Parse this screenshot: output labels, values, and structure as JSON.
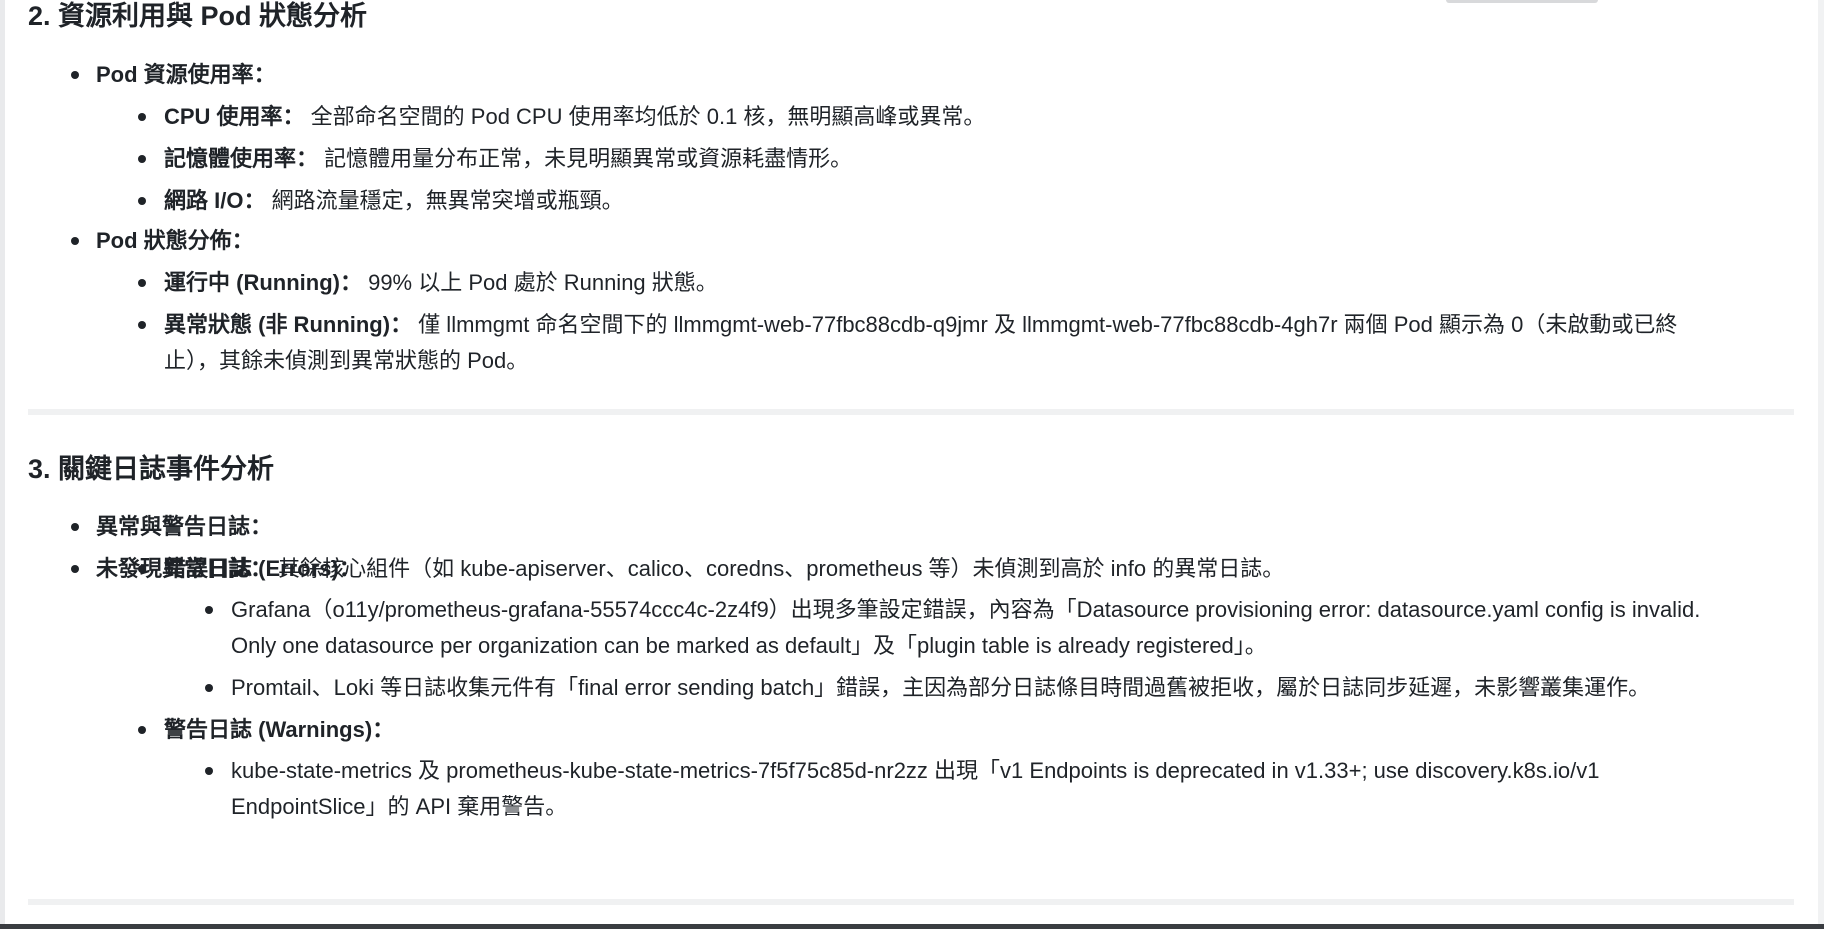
{
  "section2": {
    "title": "2. 資源利用與 Pod 狀態分析",
    "items": [
      {
        "label": "Pod 資源使用率：",
        "children": [
          {
            "label": "CPU 使用率：",
            "text": " 全部命名空間的 Pod CPU 使用率均低於 0.1 核，無明顯高峰或異常。"
          },
          {
            "label": "記憶體使用率：",
            "text": " 記憶體用量分布正常，未見明顯異常或資源耗盡情形。"
          },
          {
            "label": "網路 I/O：",
            "text": " 網路流量穩定，無異常突增或瓶頸。"
          }
        ]
      },
      {
        "label": "Pod 狀態分佈：",
        "children": [
          {
            "label": "運行中 (Running)：",
            "text": " 99% 以上 Pod 處於 Running 狀態。"
          },
          {
            "label": "異常狀態 (非 Running)：",
            "text": " 僅 llmmgmt 命名空間下的 llmmgmt-web-77fbc88cdb-q9jmr 及 llmmgmt-web-77fbc88cdb-4gh7r 兩個 Pod 顯示為 0（未啟動或已終",
            "text2": "止），其餘未偵測到異常狀態的 Pod。"
          }
        ]
      }
    ]
  },
  "section3": {
    "title": "3. 關鍵日誌事件分析",
    "items": [
      {
        "label": "異常與警告日誌：",
        "children": [
          {
            "label": "錯誤日誌 (Errors)：",
            "children": [
              {
                "line1": "Grafana（o11y/prometheus-grafana-55574ccc4c-2z4f9）出現多筆設定錯誤，內容為「Datasource provisioning error: datasource.yaml config is invalid.",
                "line2": "Only one datasource per organization can be marked as default」及「plugin table is already registered」。"
              },
              {
                "line1": "Promtail、Loki 等日誌收集元件有「final error sending batch」錯誤，主因為部分日誌條目時間過舊被拒收，屬於日誌同步延遲，未影響叢集運作。"
              }
            ]
          },
          {
            "label": "警告日誌 (Warnings)：",
            "children": [
              {
                "line1": "kube-state-metrics 及 prometheus-kube-state-metrics-7f5f75c85d-nr2zz 出現「v1 Endpoints is deprecated in v1.33+; use discovery.k8s.io/v1",
                "line2": "EndpointSlice」的 API 棄用警告。"
              }
            ]
          }
        ]
      },
      {
        "label": "未發現異常日誌：",
        "text": " 其餘核心組件（如 kube-apiserver、calico、coredns、prometheus 等）未偵測到高於 info 的異常日誌。"
      }
    ]
  }
}
